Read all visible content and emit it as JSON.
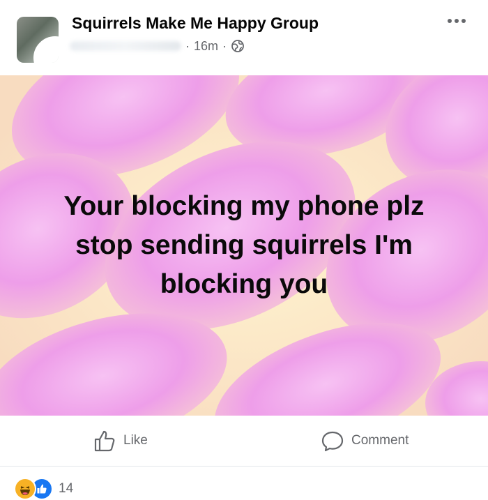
{
  "header": {
    "group_name": "Squirrels Make Me Happy Group",
    "separator": "·",
    "timestamp": "16m",
    "privacy_icon": "globe-icon",
    "more_icon": "ellipsis-icon"
  },
  "post": {
    "text_lines": [
      "Your blocking my phone plz",
      "stop sending squirrels I'm",
      "blocking you"
    ],
    "background": {
      "pink": "#f2a7ee",
      "yellow": "#fbe7b5"
    }
  },
  "actions": {
    "like_label": "Like",
    "comment_label": "Comment"
  },
  "reactions": {
    "icons": [
      "haha-reaction-icon",
      "like-reaction-icon"
    ],
    "count": "14"
  },
  "colors": {
    "accent": "#1877f2",
    "muted": "#65676b"
  }
}
